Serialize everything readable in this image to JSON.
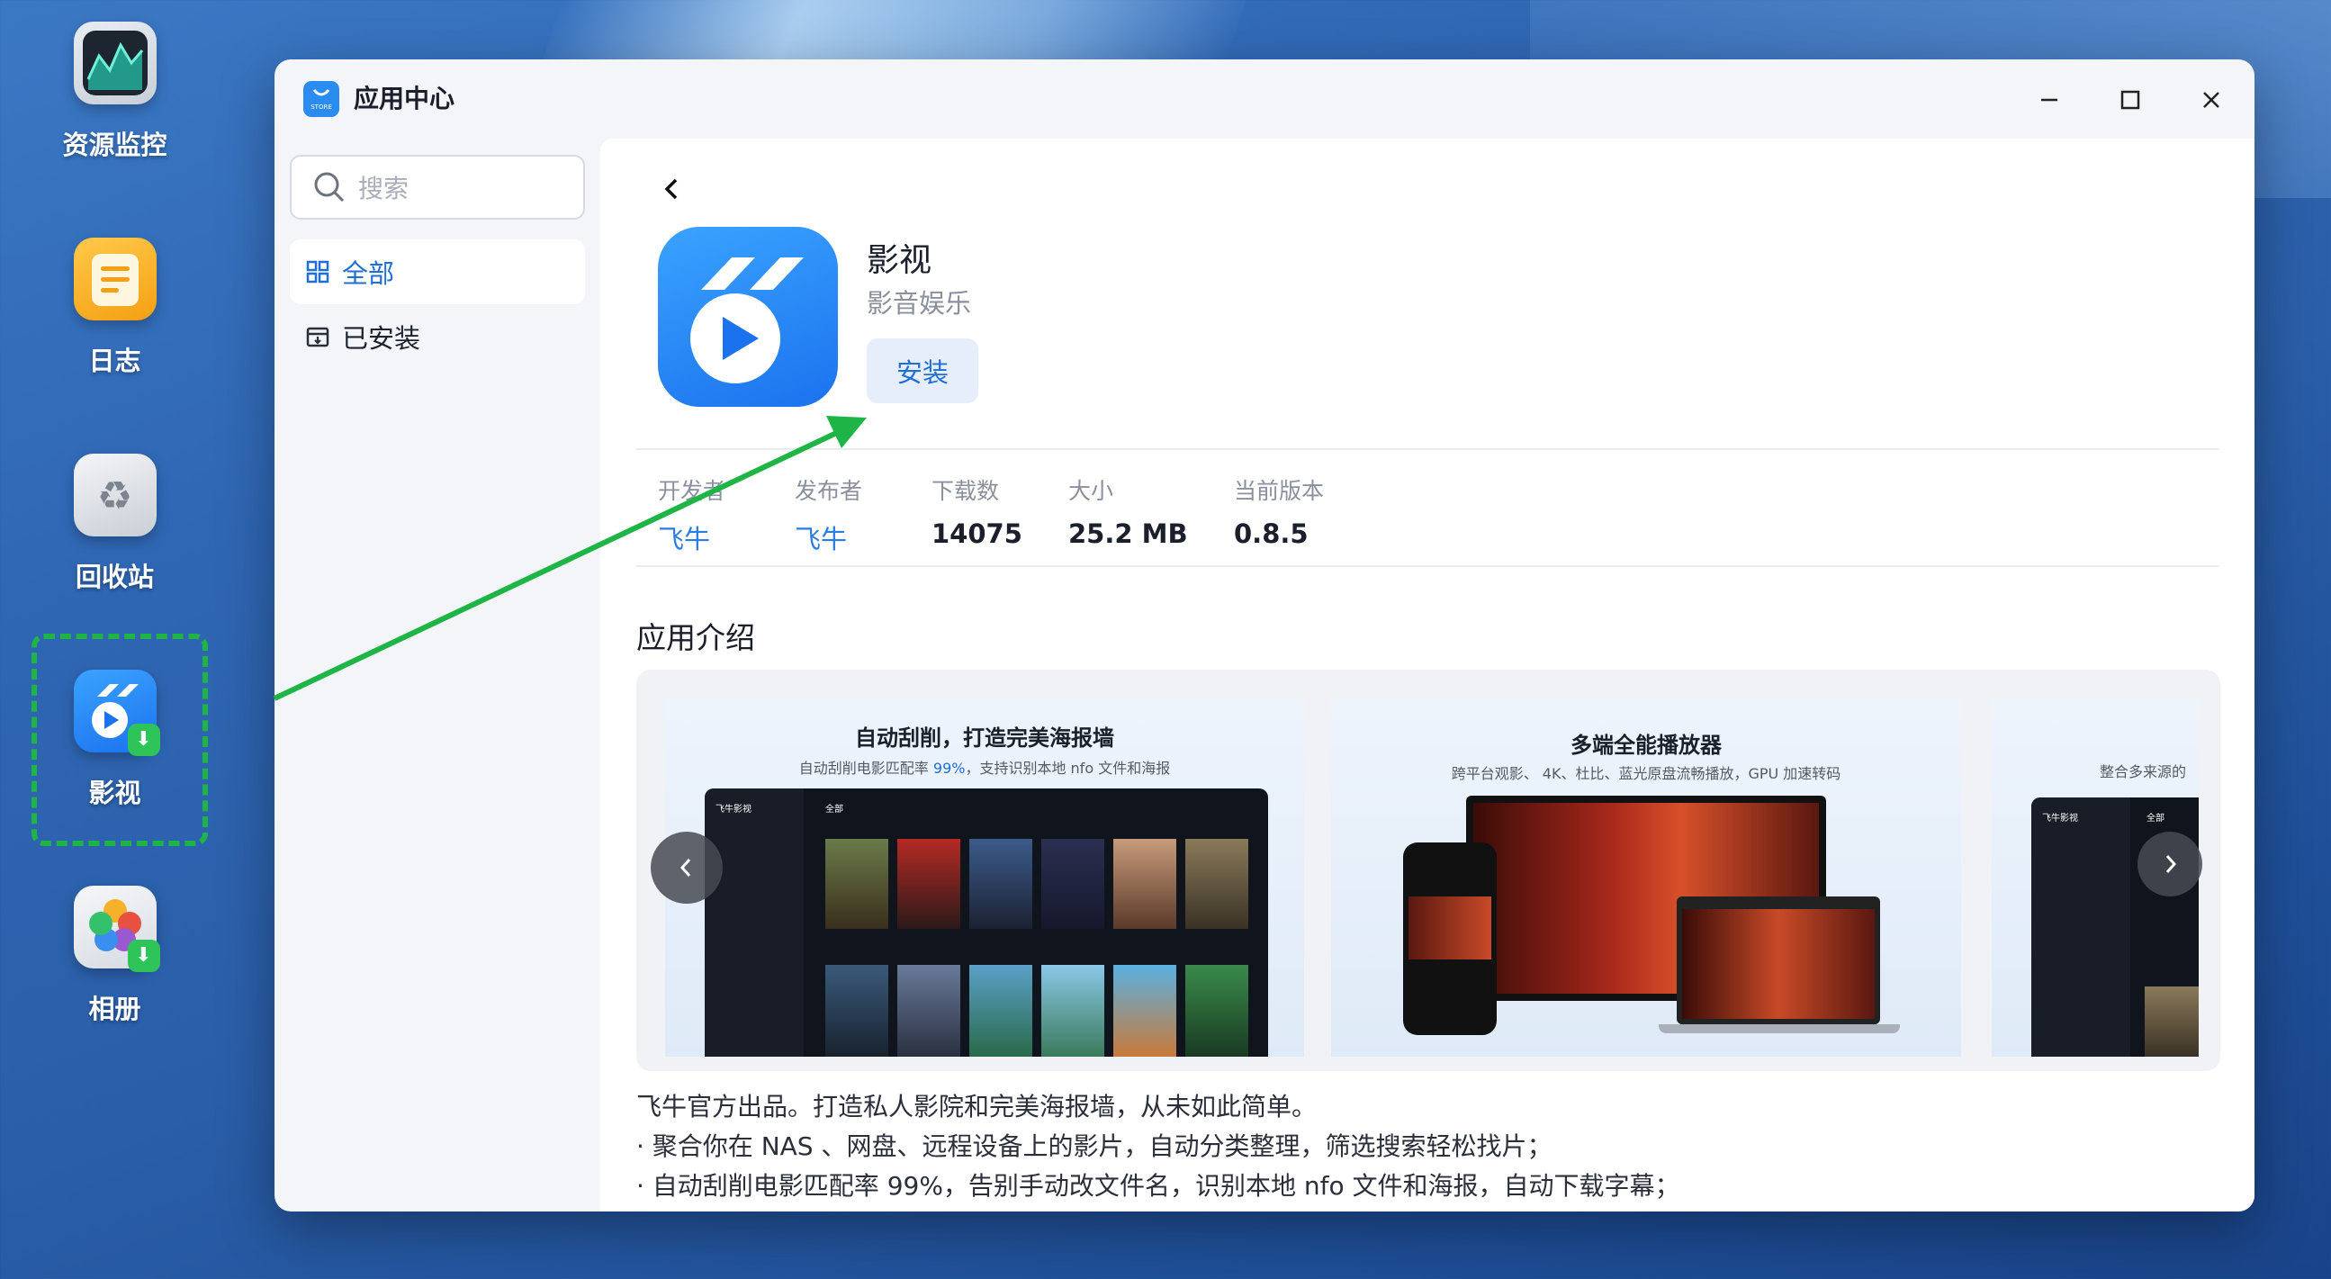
{
  "desktop": {
    "icons": [
      {
        "label": "资源监控"
      },
      {
        "label": "日志"
      },
      {
        "label": "回收站"
      },
      {
        "label": "影视"
      },
      {
        "label": "相册"
      }
    ]
  },
  "window": {
    "title": "应用中心",
    "logo_text": "STORE"
  },
  "sidebar": {
    "search_placeholder": "搜索",
    "items": [
      {
        "label": "全部",
        "active": true
      },
      {
        "label": "已安装",
        "active": false
      }
    ]
  },
  "app": {
    "name": "影视",
    "category": "影音娱乐",
    "install_label": "安装",
    "meta": [
      {
        "key": "开发者",
        "value": "飞牛",
        "link": true
      },
      {
        "key": "发布者",
        "value": "飞牛",
        "link": true
      },
      {
        "key": "下载数",
        "value": "14075",
        "link": false
      },
      {
        "key": "大小",
        "value": "25.2 MB",
        "link": false
      },
      {
        "key": "当前版本",
        "value": "0.8.5",
        "link": false
      }
    ]
  },
  "intro": {
    "title": "应用介绍",
    "screenshots": [
      {
        "heading": "自动刮削，打造完美海报墙",
        "sub_prefix": "自动刮削电影匹配率 ",
        "sub_highlight": "99%",
        "sub_suffix": "，支持识别本地 nfo 文件和海报",
        "app_label": "飞牛影视",
        "tab_label": "全部"
      },
      {
        "heading": "多端全能播放器",
        "sub": "跨平台观影、 4K、杜比、蓝光原盘流畅播放，GPU 加速转码"
      },
      {
        "sub": "整合多来源的",
        "app_label": "飞牛影视",
        "tab_label": "全部"
      }
    ],
    "description": [
      "飞牛官方出品。打造私人影院和完美海报墙，从未如此简单。",
      "· 聚合你在 NAS 、网盘、远程设备上的影片，自动分类整理，筛选搜索轻松找片；",
      "· 自动刮削电影匹配率 99%，告别手动改文件名，识别本地 nfo 文件和海报，自动下载字幕；"
    ]
  },
  "colors": {
    "accent": "#1f6fd6",
    "highlight": "#1fb546"
  }
}
